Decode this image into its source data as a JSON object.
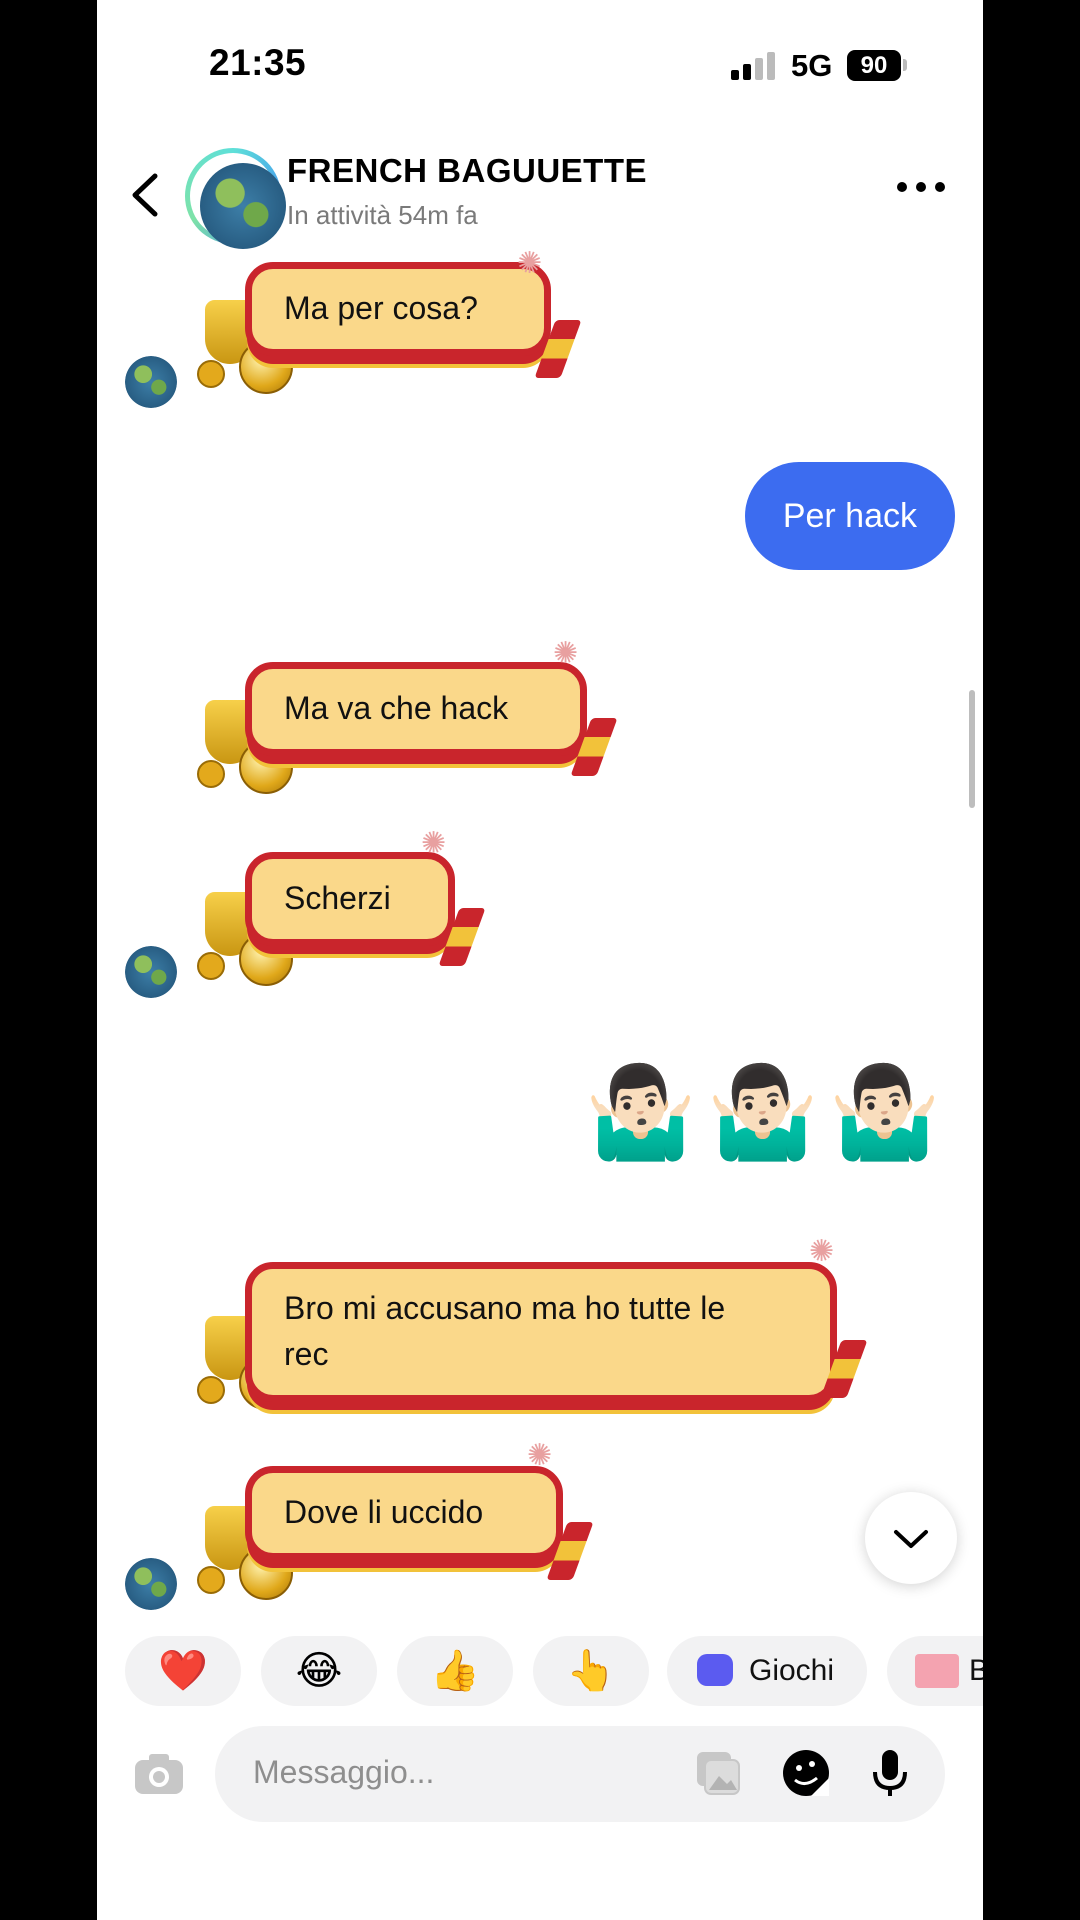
{
  "status_bar": {
    "time": "21:35",
    "network": "5G",
    "battery": "90"
  },
  "header": {
    "contact_name": "FRENCH BAGUUETTE",
    "last_active": "In attività 54m fa"
  },
  "messages": [
    {
      "from": "them",
      "text": "Ma per cosa?"
    },
    {
      "from": "me",
      "text": "Per hack"
    },
    {
      "from": "them",
      "text": "Ma va che hack"
    },
    {
      "from": "them",
      "text": "Scherzi"
    },
    {
      "from": "me",
      "text": "🤷🏻‍♂️🤷🏻‍♂️🤷🏻‍♂️"
    },
    {
      "from": "them",
      "text_line1": "Bro mi accusano ma ho tutte le",
      "text_line2": "rec"
    },
    {
      "from": "them",
      "text": "Dove li uccido"
    }
  ],
  "quick_replies": {
    "heart": "❤️",
    "laugh": "😂",
    "thumbs": "👍",
    "point": "👆",
    "games": "Giochi",
    "gift_partial": "B"
  },
  "composer": {
    "placeholder": "Messaggio..."
  },
  "colors": {
    "outgoing_bubble": "#3c6cf0",
    "theme_red": "#c9252c",
    "theme_yellow": "#fad88a"
  }
}
